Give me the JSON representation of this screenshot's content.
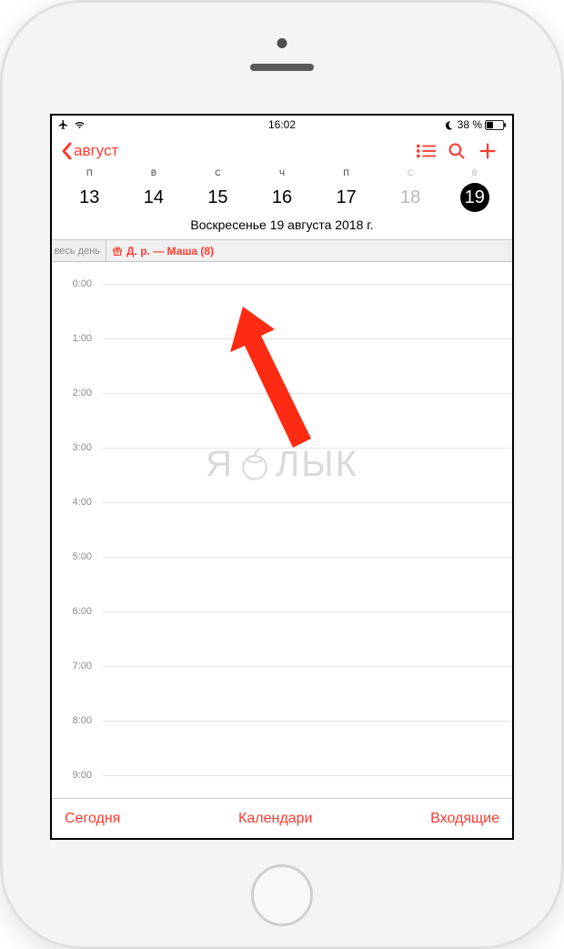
{
  "status": {
    "time": "16:02",
    "battery_text": "38 %"
  },
  "nav": {
    "back_label": "август"
  },
  "weekdays": [
    {
      "abbr": "П",
      "num": "13",
      "weekend": false,
      "selected": false
    },
    {
      "abbr": "В",
      "num": "14",
      "weekend": false,
      "selected": false
    },
    {
      "abbr": "С",
      "num": "15",
      "weekend": false,
      "selected": false
    },
    {
      "abbr": "Ч",
      "num": "16",
      "weekend": false,
      "selected": false
    },
    {
      "abbr": "П",
      "num": "17",
      "weekend": false,
      "selected": false
    },
    {
      "abbr": "С",
      "num": "18",
      "weekend": true,
      "selected": false
    },
    {
      "abbr": "В",
      "num": "19",
      "weekend": true,
      "selected": true
    }
  ],
  "date_label": "Воскресенье  19 августа 2018 г.",
  "allday": {
    "label": "весь день",
    "event_title": "Д. р. — Маша (8)"
  },
  "hours": [
    "0:00",
    "1:00",
    "2:00",
    "3:00",
    "4:00",
    "5:00",
    "6:00",
    "7:00",
    "8:00",
    "9:00"
  ],
  "watermark": {
    "left": "Я",
    "right": "ЛЫК"
  },
  "toolbar": {
    "today": "Сегодня",
    "calendars": "Календари",
    "inbox": "Входящие"
  }
}
